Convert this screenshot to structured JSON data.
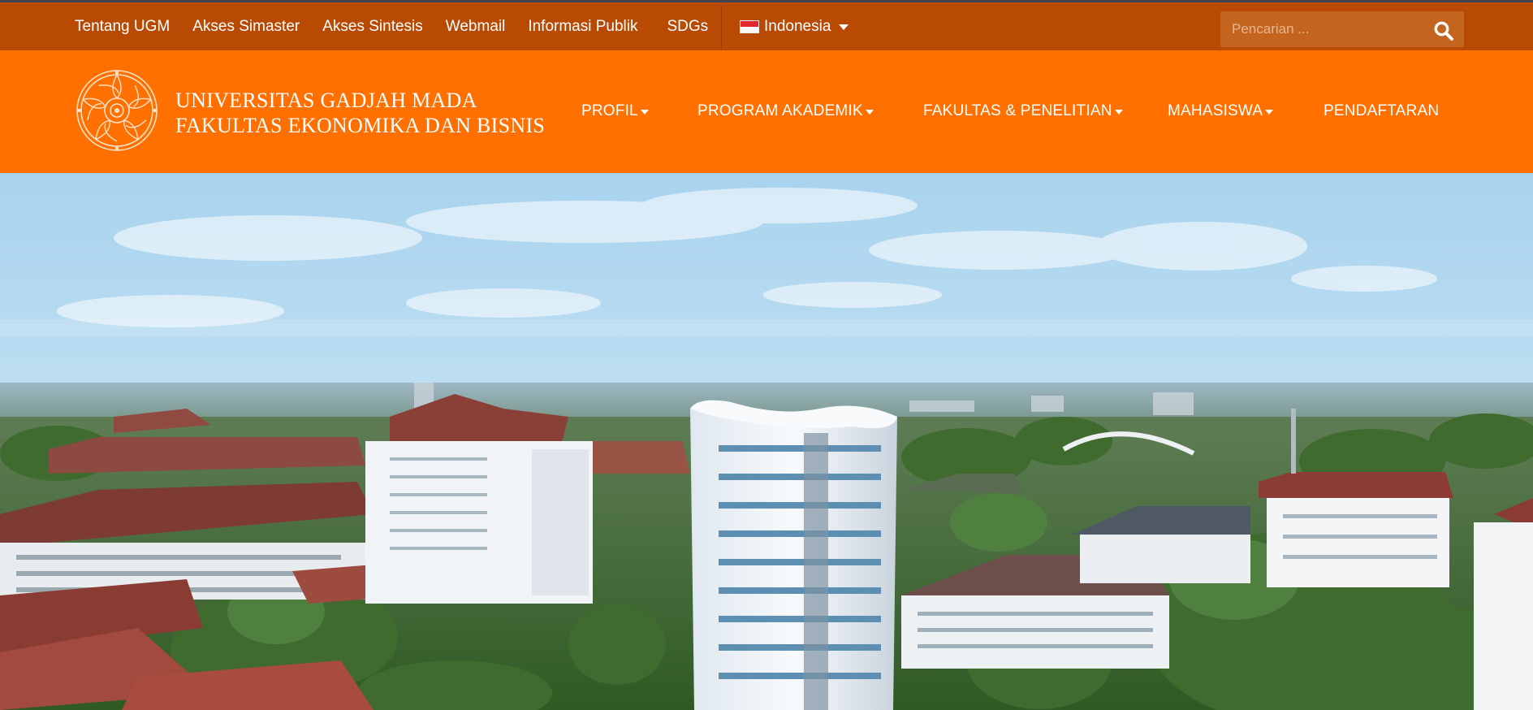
{
  "topbar": {
    "links": [
      {
        "label": "Tentang UGM"
      },
      {
        "label": "Akses Simaster"
      },
      {
        "label": "Akses Sintesis"
      },
      {
        "label": "Webmail"
      },
      {
        "label": "Informasi Publik"
      },
      {
        "label": "SDGs"
      }
    ],
    "language": {
      "label": "Indonesia",
      "flag": "indonesia-flag"
    },
    "search": {
      "placeholder": "Pencarian ...",
      "icon": "search-icon"
    }
  },
  "header": {
    "logo": "ugm-emblem",
    "title_line1": "UNIVERSITAS GADJAH MADA",
    "title_line2": "FAKULTAS EKONOMIKA DAN BISNIS"
  },
  "nav": {
    "items": [
      {
        "label": "PROFIL",
        "has_dropdown": true
      },
      {
        "label": "PROGRAM AKADEMIK",
        "has_dropdown": true
      },
      {
        "label": "FAKULTAS & PENELITIAN",
        "has_dropdown": true
      },
      {
        "label": "MAHASISWA",
        "has_dropdown": true
      },
      {
        "label": "PENDAFTARAN",
        "has_dropdown": false
      }
    ]
  },
  "hero": {
    "image": "aerial-campus-photo"
  },
  "colors": {
    "topbar_bg": "#b84a04",
    "header_bg": "#ff7000",
    "text": "#ffffff"
  }
}
